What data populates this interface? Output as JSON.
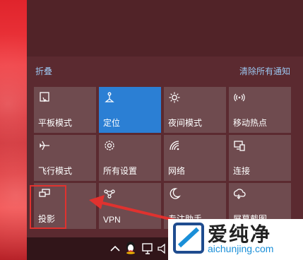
{
  "header": {
    "collapse_label": "折叠",
    "clear_all_label": "清除所有通知"
  },
  "tiles": [
    {
      "label": "平板模式",
      "icon": "tablet-mode-icon",
      "active": false
    },
    {
      "label": "定位",
      "icon": "location-icon",
      "active": true
    },
    {
      "label": "夜间模式",
      "icon": "night-light-icon",
      "active": false
    },
    {
      "label": "移动热点",
      "icon": "mobile-hotspot-icon",
      "active": false
    },
    {
      "label": "飞行模式",
      "icon": "airplane-icon",
      "active": false
    },
    {
      "label": "所有设置",
      "icon": "settings-gear-icon",
      "active": false
    },
    {
      "label": "网络",
      "icon": "network-icon",
      "active": false
    },
    {
      "label": "连接",
      "icon": "connect-icon",
      "active": false
    },
    {
      "label": "投影",
      "icon": "project-icon",
      "active": false
    },
    {
      "label": "VPN",
      "icon": "vpn-icon",
      "active": false
    },
    {
      "label": "专注助手",
      "icon": "focus-assist-icon",
      "active": false
    },
    {
      "label": "屏幕截图",
      "icon": "screen-snip-icon",
      "active": false
    }
  ],
  "annotation": {
    "highlight_color": "#e0322f"
  },
  "watermark": {
    "title": "爱纯净",
    "url": "aichunjing.com"
  },
  "colors": {
    "accent": "#2b7fd4",
    "tile": "#6f4b4f",
    "link": "#9cc7f0"
  }
}
